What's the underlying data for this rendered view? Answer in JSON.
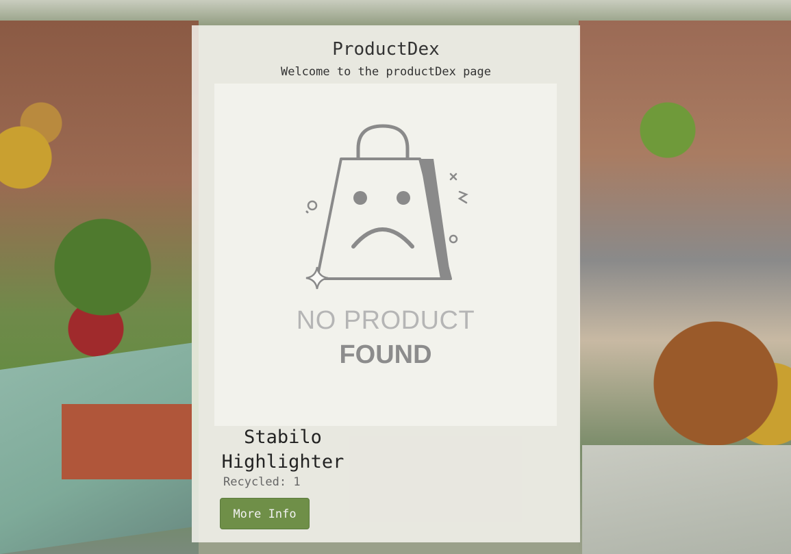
{
  "page": {
    "title": "ProductDex",
    "subtitle": "Welcome to the productDex page"
  },
  "product_image": {
    "icon": "sad-shopping-bag-icon",
    "line1": "NO PRODUCT",
    "line2": "FOUND"
  },
  "product": {
    "name": "Stabilo Highlighter",
    "recycled_text": "Recycled: 1",
    "button_label": "More Info"
  },
  "colors": {
    "button": "#6f8f48",
    "card": "#f7f5f1"
  }
}
